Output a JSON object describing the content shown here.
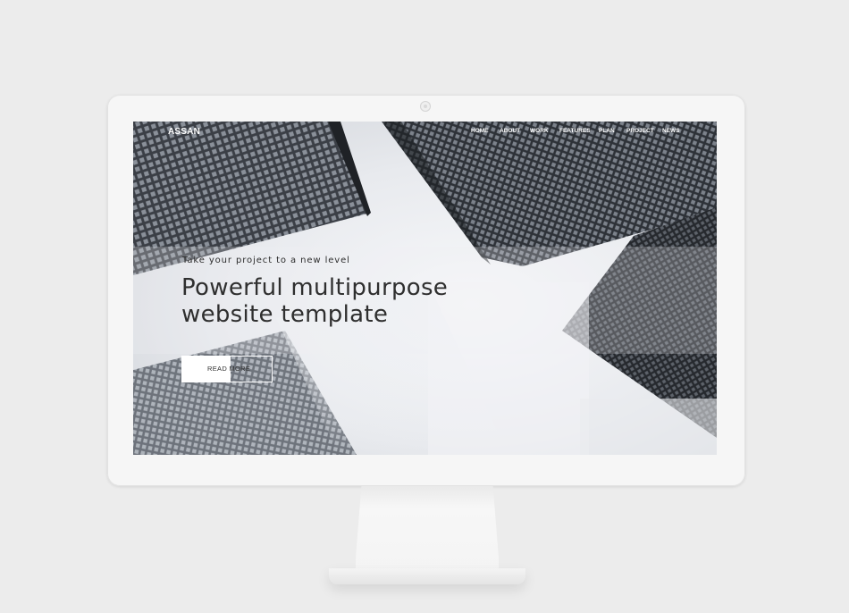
{
  "site": {
    "brand": "ASSAN",
    "nav": [
      {
        "label": "HOME"
      },
      {
        "label": "ABOUT"
      },
      {
        "label": "WORK"
      },
      {
        "label": "FEATURES"
      },
      {
        "label": "PLAN"
      },
      {
        "label": "PROJECT"
      },
      {
        "label": "NEWS"
      }
    ]
  },
  "hero": {
    "kicker": "Take your project to a new level",
    "headline_line1": "Powerful multipurpose",
    "headline_line2": "website template",
    "cta_label": "READ MORE",
    "background_image": "skyscrapers-looking-up"
  },
  "colors": {
    "page_background": "#ececec",
    "monitor_bezel": "#f6f6f6",
    "headline_text": "#2f2f2f",
    "nav_text": "#ffffff"
  }
}
